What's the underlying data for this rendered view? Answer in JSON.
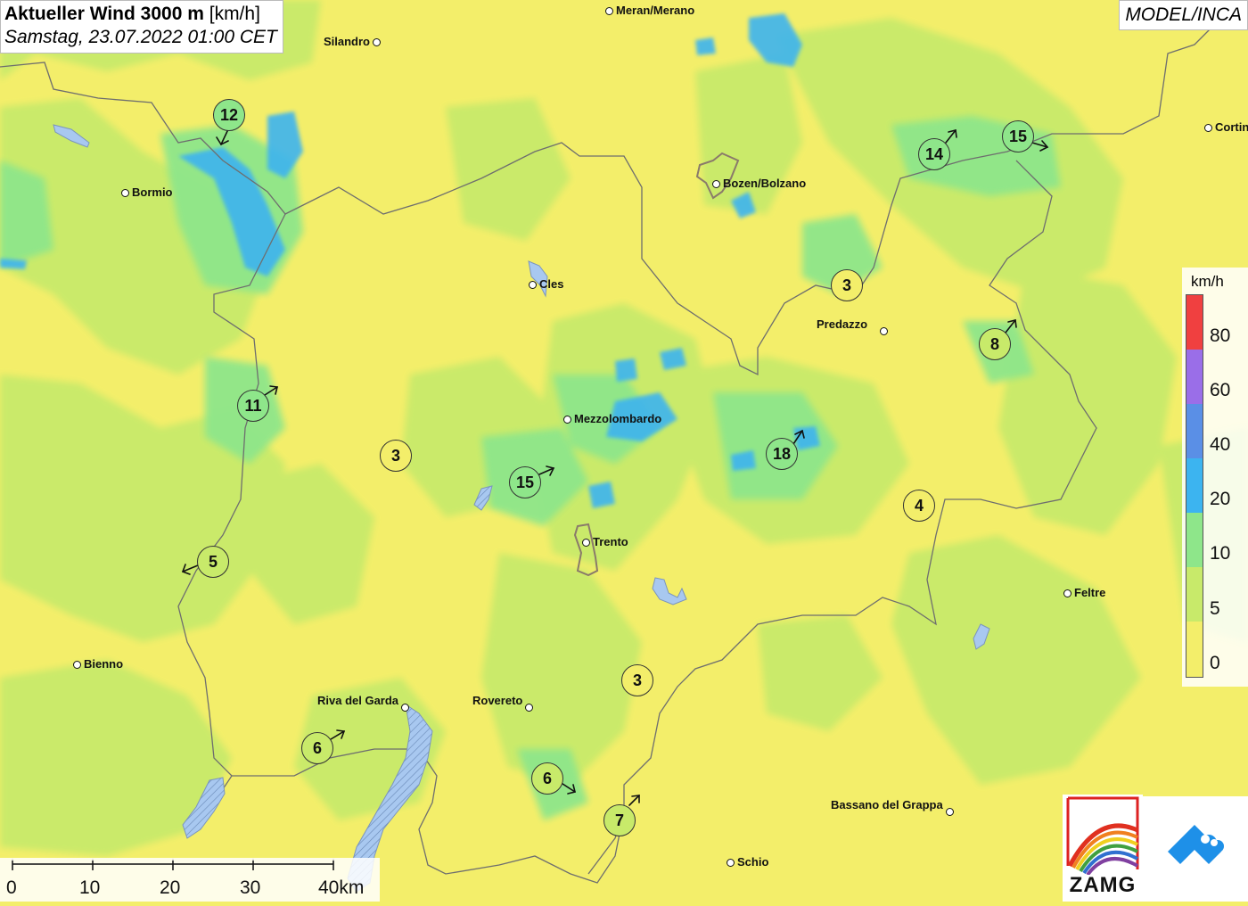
{
  "title": {
    "line1_bold": "Aktueller Wind 3000 m",
    "line1_unit": "[km/h]",
    "line2": "Samstag, 23.07.2022 01:00 CET"
  },
  "model_label": "MODEL/INCA",
  "colors": {
    "base_yellow": "#f3ee6a",
    "green_light": "#c8ea6a",
    "green": "#8ee68a",
    "cyan": "#3cb4f0",
    "blue": "#5a8fe6",
    "purple": "#9a6ee8",
    "red": "#f04040",
    "border_line": "#6e6e6e"
  },
  "cities": [
    {
      "name": "Meran/Merano"
    },
    {
      "name": "Silandro"
    },
    {
      "name": "Bormio"
    },
    {
      "name": "Bozen/Bolzano"
    },
    {
      "name": "Cortina"
    },
    {
      "name": "Cles"
    },
    {
      "name": "Predazzo"
    },
    {
      "name": "Mezzolombardo"
    },
    {
      "name": "Trento"
    },
    {
      "name": "Feltre"
    },
    {
      "name": "Bienno"
    },
    {
      "name": "Riva del Garda"
    },
    {
      "name": "Rovereto"
    },
    {
      "name": "Bassano del Grappa"
    },
    {
      "name": "Schio"
    }
  ],
  "wind_markers": [
    {
      "speed": "12",
      "direction": "S"
    },
    {
      "speed": "11",
      "direction": "NE"
    },
    {
      "speed": "5",
      "direction": "W"
    },
    {
      "speed": "6",
      "direction": "NE"
    },
    {
      "speed": "3",
      "direction": "calm"
    },
    {
      "speed": "15",
      "direction": "NE"
    },
    {
      "speed": "6",
      "direction": "SE"
    },
    {
      "speed": "7",
      "direction": "NE"
    },
    {
      "speed": "3",
      "direction": "calm"
    },
    {
      "speed": "18",
      "direction": "NE"
    },
    {
      "speed": "3",
      "direction": "calm"
    },
    {
      "speed": "14",
      "direction": "NE"
    },
    {
      "speed": "15",
      "direction": "E"
    },
    {
      "speed": "8",
      "direction": "NE"
    },
    {
      "speed": "4",
      "direction": "calm"
    }
  ],
  "legend": {
    "unit": "km/h",
    "ticks": [
      "80",
      "60",
      "40",
      "20",
      "10",
      "5",
      "0"
    ]
  },
  "scale_bar": {
    "labels": [
      "0",
      "10",
      "20",
      "30",
      "40km"
    ]
  },
  "logos": {
    "zamg": "ZAMG"
  }
}
